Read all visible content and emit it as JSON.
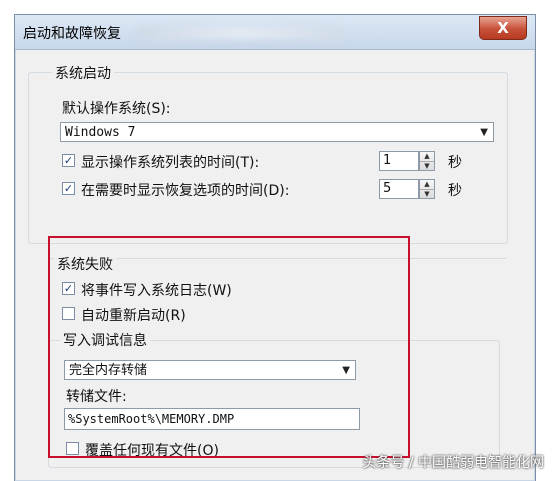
{
  "window": {
    "title": "启动和故障恢复",
    "close_label": "X"
  },
  "system_startup": {
    "legend": "系统启动",
    "default_os_label": "默认操作系统(S):",
    "default_os_value": "Windows 7",
    "show_os_list": {
      "label": "显示操作系统列表的时间(T):",
      "checked": true,
      "value": "1",
      "unit": "秒"
    },
    "show_recovery": {
      "label": "在需要时显示恢复选项的时间(D):",
      "checked": true,
      "value": "5",
      "unit": "秒"
    }
  },
  "system_failure": {
    "legend": "系统失败",
    "write_event": {
      "label": "将事件写入系统日志(W)",
      "checked": true
    },
    "auto_restart": {
      "label": "自动重新启动(R)",
      "checked": false
    },
    "debug_info_legend": "写入调试信息",
    "debug_type_value": "完全内存转储",
    "dump_file_label": "转储文件:",
    "dump_file_value": "%SystemRoot%\\MEMORY.DMP",
    "overwrite": {
      "label": "覆盖任何现有文件(O)",
      "checked": false
    }
  },
  "icons": {
    "check_mark": "✓",
    "dropdown": "▼",
    "spin_up": "▲",
    "spin_down": "▼"
  },
  "colors": {
    "highlight": "#c8102e"
  },
  "watermark": "头条号 / 中国酷弱电智能化网"
}
